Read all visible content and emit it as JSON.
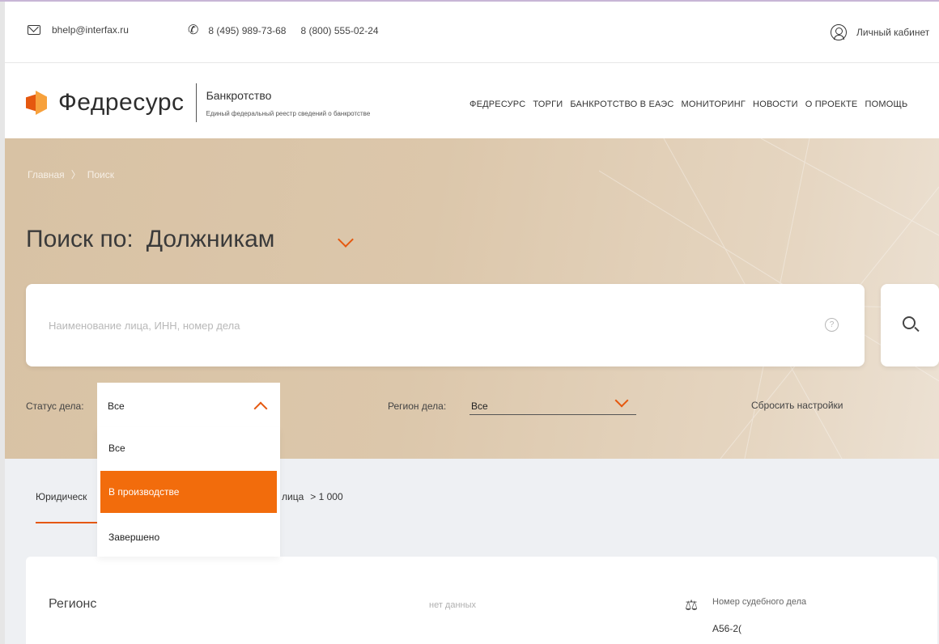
{
  "topbar": {
    "email": "bhelp@interfax.ru",
    "phone1": "8 (495) 989-73-68",
    "phone2": "8 (800) 555-02-24",
    "cabinet": "Личный кабинет"
  },
  "header": {
    "logo_name": "Федресурс",
    "section_title": "Банкротство",
    "section_subtitle": "Единый федеральный реестр сведений о банкротстве",
    "nav": [
      "ФЕДРЕСУРС",
      "ТОРГИ",
      "БАНКРОТСТВО В ЕАЭС",
      "МОНИТОРИНГ",
      "НОВОСТИ",
      "О ПРОЕКТЕ",
      "ПОМОЩЬ"
    ]
  },
  "breadcrumb": {
    "home": "Главная",
    "separator": "〉",
    "current": "Поиск"
  },
  "search": {
    "title_prefix": "Поиск по:",
    "title_value": "Должникам",
    "placeholder": "Наименование лица, ИНН, номер дела"
  },
  "filters": {
    "status_label": "Статус дела:",
    "status_value": "Все",
    "status_options": [
      "Все",
      "В производстве",
      "Завершено"
    ],
    "highlighted_option": "В производстве",
    "region_label": "Регион дела:",
    "region_value": "Все",
    "reset_label": "Сбросить настройки"
  },
  "tabs": {
    "legal": "Юридическ",
    "physical": "лица",
    "physical_count": "> 1 000"
  },
  "result_card": {
    "region": "Регионс",
    "no_data": "нет данных",
    "case_label": "Номер судебного дела",
    "case_number": "А56-2("
  },
  "colors": {
    "accent": "#e5580f",
    "highlight": "#f26c0c",
    "hero_bg": "#dcc7ab"
  }
}
